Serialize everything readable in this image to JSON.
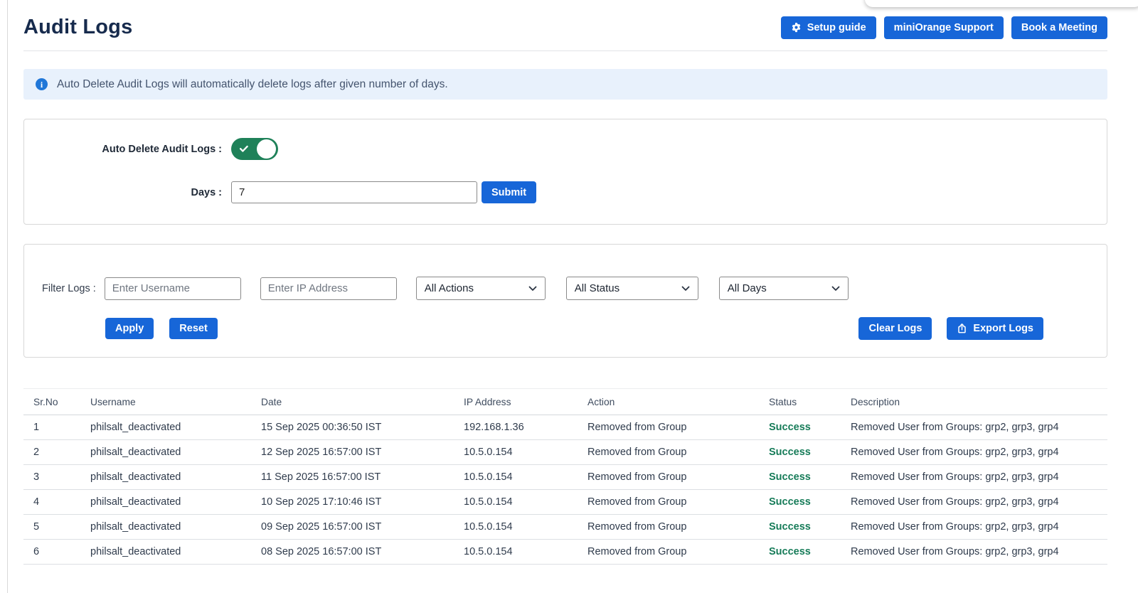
{
  "page": {
    "title": "Audit Logs"
  },
  "header": {
    "buttons": [
      {
        "label": "Setup guide",
        "icon": "gear-icon"
      },
      {
        "label": "miniOrange Support"
      },
      {
        "label": "Book a Meeting"
      }
    ]
  },
  "info_banner": {
    "text": "Auto Delete Audit Logs will automatically delete logs after given number of days."
  },
  "icons": {
    "info_glyph": "i"
  },
  "auto_delete": {
    "label": "Auto Delete Audit Logs :",
    "toggle_state": "on",
    "days_label": "Days :",
    "days_value": "7",
    "submit_label": "Submit"
  },
  "filters": {
    "label": "Filter Logs :",
    "username_placeholder": "Enter Username",
    "ip_placeholder": "Enter IP Address",
    "actions_selected": "All Actions",
    "status_selected": "All Status",
    "days_selected": "All Days",
    "apply_label": "Apply",
    "reset_label": "Reset",
    "clear_logs_label": "Clear Logs",
    "export_logs_label": "Export Logs"
  },
  "table": {
    "columns": [
      "Sr.No",
      "Username",
      "Date",
      "IP Address",
      "Action",
      "Status",
      "Description"
    ],
    "rows": [
      {
        "sr": "1",
        "username": "philsalt_deactivated",
        "date": "15 Sep 2025 00:36:50 IST",
        "ip": "192.168.1.36",
        "action": "Removed from Group",
        "status": "Success",
        "description": "Removed User from Groups: grp2, grp3, grp4"
      },
      {
        "sr": "2",
        "username": "philsalt_deactivated",
        "date": "12 Sep 2025 16:57:00 IST",
        "ip": "10.5.0.154",
        "action": "Removed from Group",
        "status": "Success",
        "description": "Removed User from Groups: grp2, grp3, grp4"
      },
      {
        "sr": "3",
        "username": "philsalt_deactivated",
        "date": "11 Sep 2025 16:57:00 IST",
        "ip": "10.5.0.154",
        "action": "Removed from Group",
        "status": "Success",
        "description": "Removed User from Groups: grp2, grp3, grp4"
      },
      {
        "sr": "4",
        "username": "philsalt_deactivated",
        "date": "10 Sep 2025 17:10:46 IST",
        "ip": "10.5.0.154",
        "action": "Removed from Group",
        "status": "Success",
        "description": "Removed User from Groups: grp2, grp3, grp4"
      },
      {
        "sr": "5",
        "username": "philsalt_deactivated",
        "date": "09 Sep 2025 16:57:00 IST",
        "ip": "10.5.0.154",
        "action": "Removed from Group",
        "status": "Success",
        "description": "Removed User from Groups: grp2, grp3, grp4"
      },
      {
        "sr": "6",
        "username": "philsalt_deactivated",
        "date": "08 Sep 2025 16:57:00 IST",
        "ip": "10.5.0.154",
        "action": "Removed from Group",
        "status": "Success",
        "description": "Removed User from Groups: grp2, grp3, grp4"
      }
    ]
  },
  "colors": {
    "primary_blue": "#1766D8",
    "success_green": "#177C59",
    "info_banner_bg": "#E8F1FC",
    "toggle_on_green": "#1F8159",
    "title_navy": "#172B4D"
  }
}
